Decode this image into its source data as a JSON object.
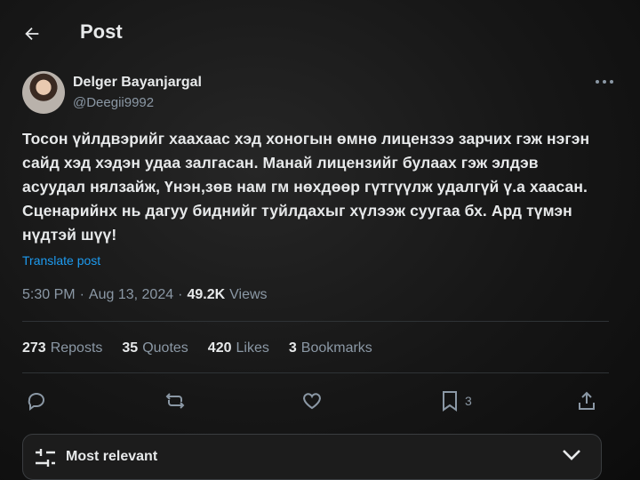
{
  "header": {
    "title": "Post"
  },
  "author": {
    "name": "Delger Bayanjargal",
    "handle": "@Deegii9992"
  },
  "tweet": {
    "lines": [
      "Тосон үйлдвэрийг хаахаас хэд хоногын өмнө лицензээ зарчих гэж нэгэн",
      "сайд хэд хэдэн удаа залгасан.  Манай лицензийг булаах гэж элдэв",
      "асуудал нялзайж, Үнэн,зөв нам гм нөхдөөр гүтгүүлж удалгүй ү.а хаасан.",
      "Сценарийнх нь дагуу биднийг туйлдахыг хүлээж суугаа бх. Ард  түмэн",
      "нүдтэй шүү!"
    ],
    "translate_label": "Translate post",
    "time": "5:30 PM",
    "date": "Aug 13, 2024",
    "views_count": "49.2K",
    "views_label": "Views",
    "sep": "·"
  },
  "stats": {
    "reposts_count": "273",
    "reposts_label": "Reposts",
    "quotes_count": "35",
    "quotes_label": "Quotes",
    "likes_count": "420",
    "likes_label": "Likes",
    "bookmarks_count": "3",
    "bookmarks_label": "Bookmarks"
  },
  "actions": {
    "reply_icon": "reply-icon",
    "repost_icon": "repost-icon",
    "like_icon": "heart-icon",
    "bookmark_icon": "bookmark-icon",
    "bookmark_count": "3",
    "share_icon": "share-icon"
  },
  "sort": {
    "label": "Most relevant"
  },
  "colors": {
    "accent": "#1d9bf0",
    "text": "#e7e9ea",
    "muted": "#8b98a5",
    "background": "#141414"
  }
}
